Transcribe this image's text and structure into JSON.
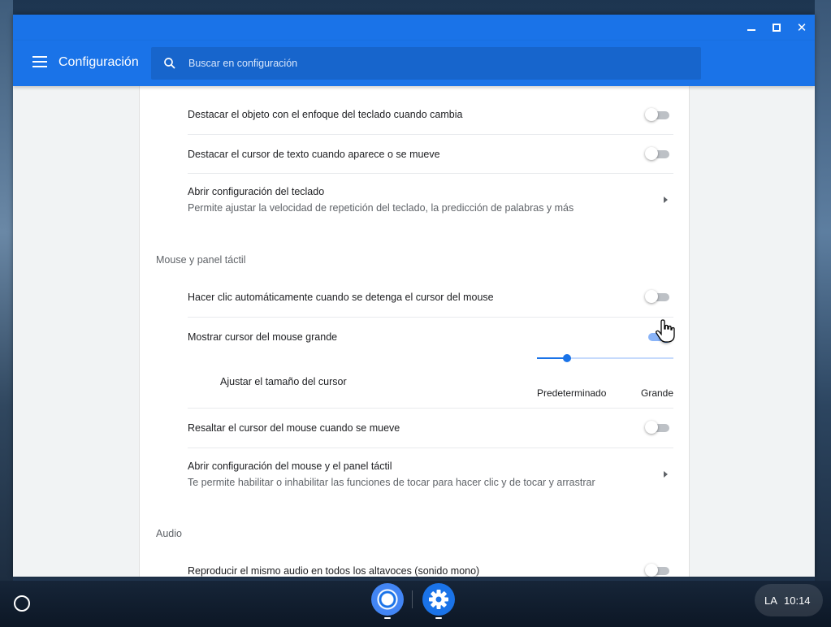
{
  "window": {
    "title": "Configuración",
    "controls": [
      "minimize",
      "maximize",
      "close"
    ]
  },
  "header": {
    "title": "Configuración",
    "menu_icon": "hamburger-menu-icon",
    "search": {
      "placeholder": "Buscar en configuración",
      "value": ""
    }
  },
  "settings": {
    "keyboard": {
      "highlight_focus": {
        "label": "Destacar el objeto con el enfoque del teclado cuando cambia",
        "enabled": false
      },
      "highlight_text_cursor": {
        "label": "Destacar el cursor de texto cuando aparece o se mueve",
        "enabled": false
      },
      "open_keyboard": {
        "label": "Abrir configuración del teclado",
        "description": "Permite ajustar la velocidad de repetición del teclado, la predicción de palabras y más"
      }
    },
    "mouse": {
      "section_title": "Mouse y panel táctil",
      "auto_click": {
        "label": "Hacer clic automáticamente cuando se detenga el cursor del mouse",
        "enabled": false
      },
      "large_cursor": {
        "label": "Mostrar cursor del mouse grande",
        "enabled": true
      },
      "cursor_size": {
        "label": "Ajustar el tamaño del cursor",
        "min_label": "Predeterminado",
        "max_label": "Grande",
        "value": 0.2
      },
      "highlight_cursor": {
        "label": "Resaltar el cursor del mouse cuando se mueve",
        "enabled": false
      },
      "open_mouse": {
        "label": "Abrir configuración del mouse y el panel táctil",
        "description": "Te permite habilitar o inhabilitar las funciones de tocar para hacer clic y de tocar y arrastrar"
      }
    },
    "audio": {
      "section_title": "Audio",
      "mono_audio": {
        "label": "Reproducir el mismo audio en todos los altavoces (sonido mono)",
        "enabled": false
      }
    }
  },
  "shelf": {
    "launcher_icon": "launcher-circle-icon",
    "apps": [
      "chrome-icon",
      "settings-gear-icon"
    ],
    "tray": {
      "language": "LA",
      "time": "10:14"
    }
  },
  "colors": {
    "accent": "#1a73e8",
    "toggle_off": "#bdc1c6",
    "toggle_on_track": "#8ab4f8"
  }
}
